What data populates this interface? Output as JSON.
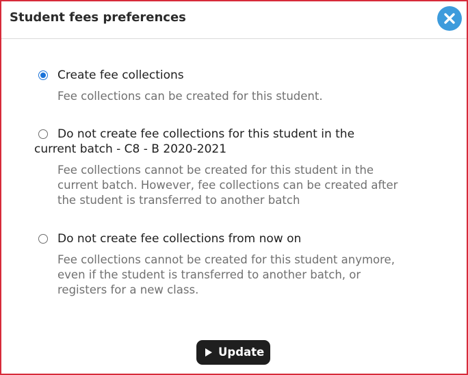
{
  "dialog": {
    "title": "Student fees preferences",
    "close_icon": "close-icon",
    "accent_color": "#3d9bdc",
    "border_color": "#d72b3a"
  },
  "options": [
    {
      "label": "Create fee collections",
      "selected": true,
      "description_lines": [
        "Fee collections can be created for this student."
      ]
    },
    {
      "label_lines": [
        "Do not create fee collections for this student in the",
        "current batch - C8 - B 2020-2021"
      ],
      "selected": false,
      "description_lines": [
        "Fee collections cannot be created for this student in the",
        "current batch. However, fee collections can be created after",
        "the student is transferred to another batch"
      ]
    },
    {
      "label": "Do not create fee collections from now on",
      "selected": false,
      "description_lines": [
        "Fee collections cannot be created for this student anymore,",
        "even if the student is transferred to another batch, or",
        "registers for a new class."
      ]
    }
  ],
  "update_button": {
    "label": "Update",
    "icon": "play-icon"
  }
}
